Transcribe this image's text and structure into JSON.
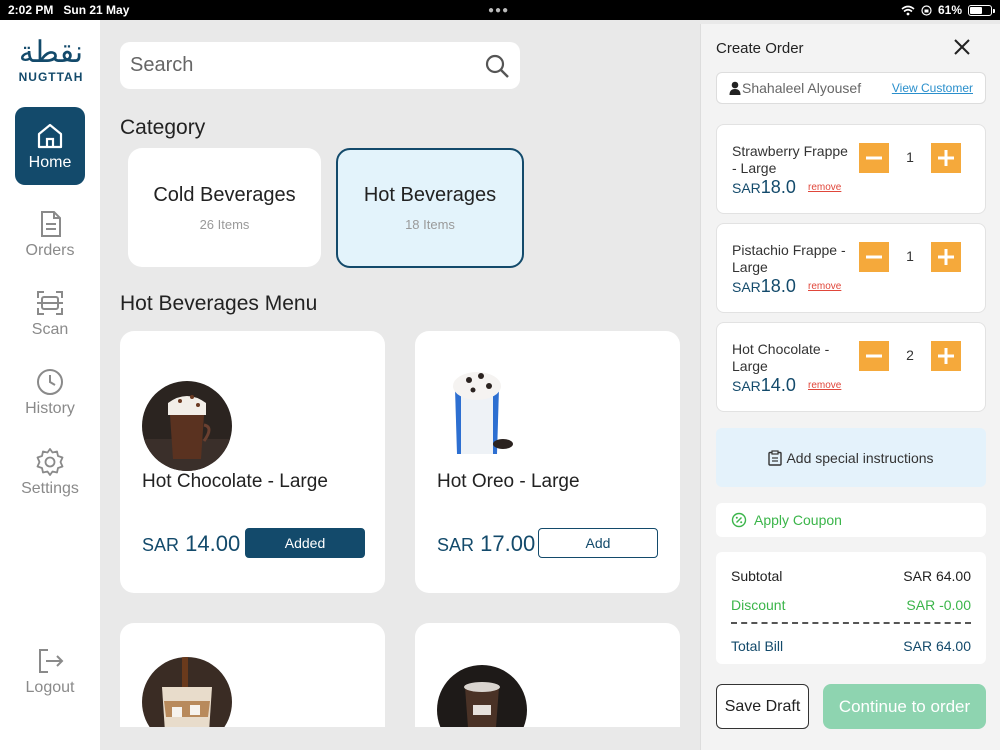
{
  "status_bar": {
    "time": "2:02 PM",
    "date": "Sun 21 May",
    "battery": "61%",
    "battery_level": 0.61
  },
  "brand": {
    "arabic": "نقطة",
    "name": "NUGTTAH"
  },
  "nav": [
    {
      "label": "Home",
      "icon": "home-icon",
      "active": true
    },
    {
      "label": "Orders",
      "icon": "document-icon"
    },
    {
      "label": "Scan",
      "icon": "scan-icon"
    },
    {
      "label": "History",
      "icon": "clock-icon"
    },
    {
      "label": "Settings",
      "icon": "gear-icon"
    },
    {
      "label": "Logout",
      "icon": "logout-icon"
    }
  ],
  "search": {
    "placeholder": "Search"
  },
  "category_title": "Category",
  "categories": [
    {
      "name": "Cold Beverages",
      "count": "26 Items",
      "active": false
    },
    {
      "name": "Hot Beverages",
      "count": "18 Items",
      "active": true
    }
  ],
  "menu_title": "Hot Beverages Menu",
  "products": [
    {
      "name": "Hot Chocolate - Large",
      "currency": "SAR",
      "price": "14.00",
      "button": "Added"
    },
    {
      "name": "Hot Oreo - Large",
      "currency": "SAR",
      "price": "17.00",
      "button": "Add"
    },
    {
      "name": "",
      "currency": "",
      "price": "",
      "button": ""
    },
    {
      "name": "",
      "currency": "",
      "price": "",
      "button": ""
    }
  ],
  "order": {
    "title": "Create Order",
    "customer": "Shahaleel Alyousef",
    "view_customer": "View Customer",
    "items": [
      {
        "name": "Strawberry Frappe - Large",
        "currency": "SAR",
        "price": "18.0",
        "qty": "1",
        "remove": "remove"
      },
      {
        "name": "Pistachio Frappe - Large",
        "currency": "SAR",
        "price": "18.0",
        "qty": "1",
        "remove": "remove"
      },
      {
        "name": "Hot Chocolate - Large",
        "currency": "SAR",
        "price": "14.0",
        "qty": "2",
        "remove": "remove"
      }
    ],
    "instructions": "Add special instructions",
    "coupon": "Apply Coupon",
    "summary": {
      "subtotal_label": "Subtotal",
      "subtotal": "SAR 64.00",
      "discount_label": "Discount",
      "discount": "SAR -0.00",
      "total_label": "Total Bill",
      "total": "SAR 64.00"
    },
    "save_draft": "Save Draft",
    "continue": "Continue to order"
  },
  "colors": {
    "primary": "#134a6b",
    "accent": "#f5a93b",
    "success": "#3bb54a",
    "continue": "#8ed4b0",
    "active_category": "#e3f3fb"
  }
}
